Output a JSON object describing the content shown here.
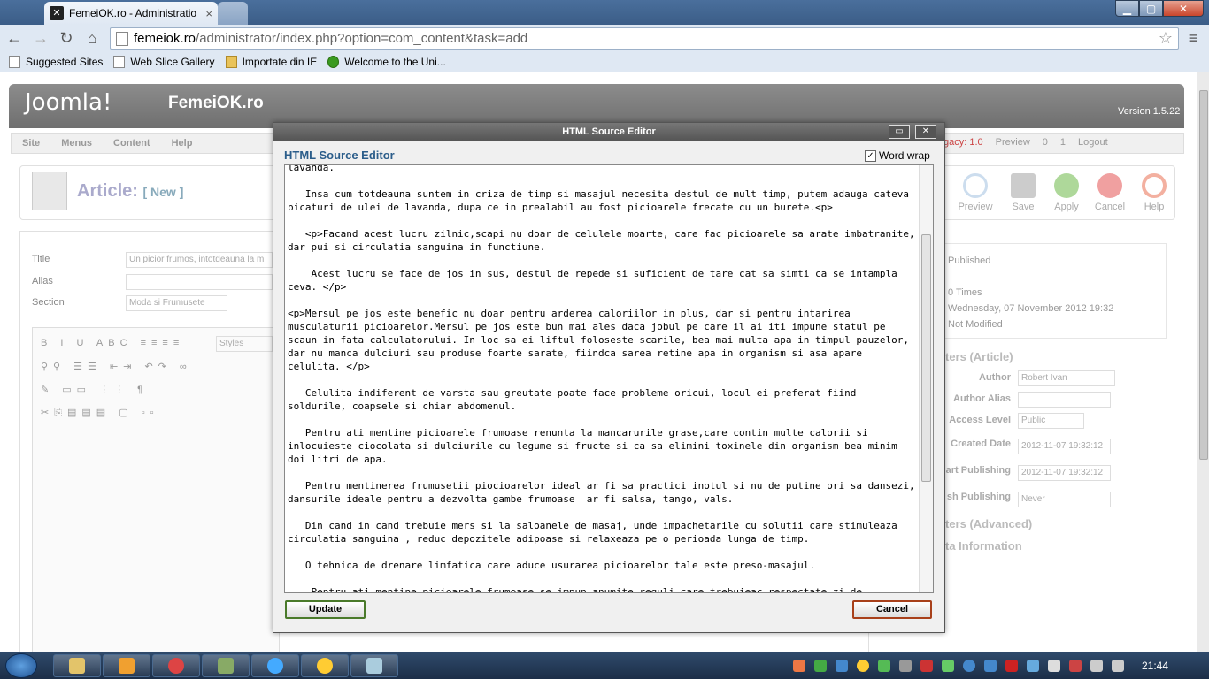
{
  "browser": {
    "tab_title": "FemeiOK.ro - Administratio",
    "tab_favicon": "joomla-favicon",
    "url_domain": "femeiok.ro",
    "url_path": "/administrator/index.php?option=com_content&task=add",
    "bookmarks": [
      "Suggested Sites",
      "Web Slice Gallery",
      "Importate din IE",
      "Welcome to the Uni..."
    ]
  },
  "joomla": {
    "logo_text": "Joomla!",
    "site_name": "FemeiOK.ro",
    "version": "Version 1.5.22",
    "menu": [
      "Site",
      "Menus",
      "Content",
      "Help"
    ],
    "status": {
      "legacy": "gacy: 1.0",
      "preview": "Preview",
      "msgs": "0",
      "users": "1",
      "logout": "Logout"
    },
    "page_title": "Article:",
    "page_subtitle": "[ New ]",
    "toolbar": [
      "Preview",
      "Save",
      "Apply",
      "Cancel",
      "Help"
    ],
    "fields": {
      "title_label": "Title",
      "title_value": "Un picior frumos, intotdeauna la m",
      "alias_label": "Alias",
      "section_label": "Section",
      "section_value": "Moda si Frumusete"
    },
    "styles_label": "Styles",
    "info": {
      "state": "Published",
      "hits": "0 Times",
      "created": "Wednesday, 07 November 2012 19:32",
      "modified": "Not Modified"
    },
    "params": {
      "header": "ters (Article)",
      "author_label": "Author",
      "author_value": "Robert Ivan",
      "author_alias_label": "Author Alias",
      "access_label": "Access Level",
      "access_value": "Public",
      "created_label": "Created Date",
      "created_value": "2012-11-07 19:32:12",
      "start_label": "art Publishing",
      "start_value": "2012-11-07 19:32:12",
      "finish_label": "sh Publishing",
      "finish_value": "Never",
      "advanced": "ters (Advanced)",
      "meta": "ta Information"
    }
  },
  "modal": {
    "window_title": "HTML Source Editor",
    "heading": "HTML Source Editor",
    "word_wrap_label": "Word wrap",
    "word_wrap_checked": "✓",
    "source": "lavanda.\n\n   Insa cum totdeauna suntem in criza de timp si masajul necesita destul de mult timp, putem adauga cateva picaturi de ulei de lavanda, dupa ce in prealabil au fost picioarele frecate cu un burete.<p>\n\n   <p>Facand acest lucru zilnic,scapi nu doar de celulele moarte, care fac picioarele sa arate imbatranite, dar pui si circulatia sanguina in functiune.\n\n    Acest lucru se face de jos in sus, destul de repede si suficient de tare cat sa simti ca se intampla ceva. </p>\n\n<p>Mersul pe jos este benefic nu doar pentru arderea caloriilor in plus, dar si pentru intarirea musculaturii picioarelor.Mersul pe jos este bun mai ales daca jobul pe care il ai iti impune statul pe scaun in fata calculatorului. In loc sa ei liftul foloseste scarile, bea mai multa apa in timpul pauzelor, dar nu manca dulciuri sau produse foarte sarate, fiindca sarea retine apa in organism si asa apare celulita. </p>\n\n   Celulita indiferent de varsta sau greutate poate face probleme oricui, locul ei preferat fiind soldurile, coapsele si chiar abdomenul.\n\n   Pentru ati mentine picioarele frumoase renunta la mancarurile grase,care contin multe calorii si inlocuieste ciocolata si dulciurile cu legume si fructe si ca sa elimini toxinele din organism bea minim doi litri de apa.\n\n   Pentru mentinerea frumusetii piocioarelor ideal ar fi sa practici inotul si nu de putine ori sa dansezi, dansurile ideale pentru a dezvolta gambe frumoase  ar fi salsa, tango, vals.\n\n   Din cand in cand trebuie mers si la saloanele de masaj, unde impachetarile cu solutii care stimuleaza circulatia sanguina , reduc depozitele adipoase si relaxeaza pe o perioada lunga de timp.\n\n   O tehnica de drenare limfatica care aduce usurarea picioarelor tale este preso-masajul.\n\n    Pentru ati mentine picioarele frumoase se impun anumite reguli care trebuieac respectate zi de",
    "update_label": "Update",
    "cancel_label": "Cancel"
  },
  "taskbar": {
    "clock": "21:44"
  },
  "colors": {
    "accent": "#2b5d8a",
    "titlebar": "#4a6f9c",
    "taskbar": "#1c2e47"
  }
}
